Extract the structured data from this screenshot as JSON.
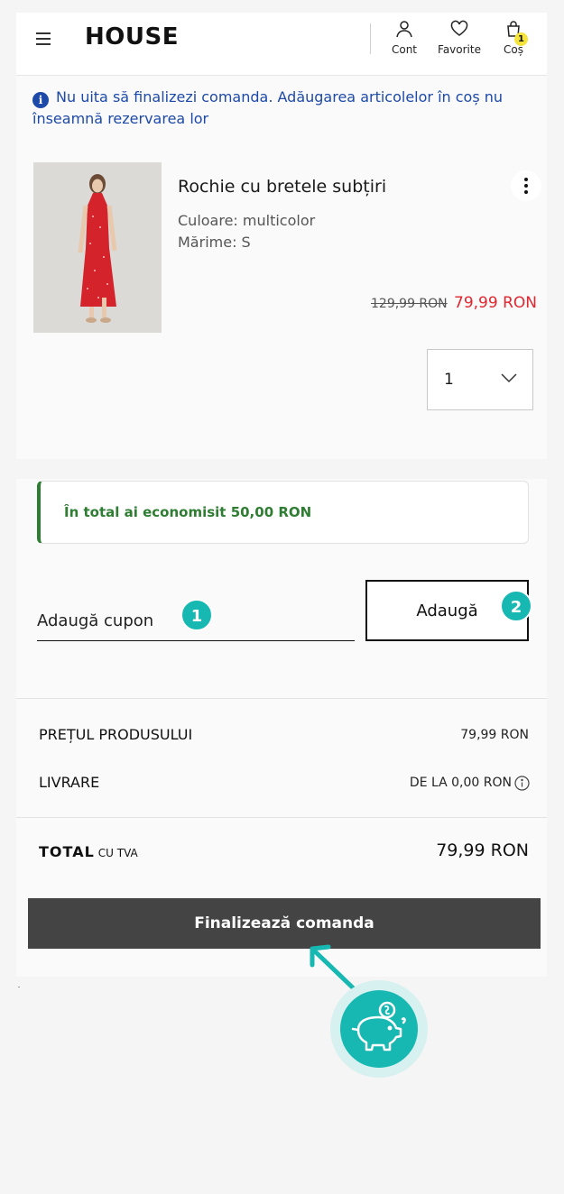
{
  "header": {
    "logo": "HOUSE",
    "account_label": "Cont",
    "favorites_label": "Favorite",
    "cart_label": "Coș",
    "cart_count": "1"
  },
  "info": {
    "message": "Nu uita să finalizezi comanda. Adăugarea articolelor în coș nu înseamnă rezervarea lor"
  },
  "product": {
    "name": "Rochie cu bretele subțiri",
    "color": "Culoare: multicolor",
    "size": "Mărime: S",
    "old_price": "129,99 RON",
    "new_price": "79,99 RON",
    "quantity": "1"
  },
  "savings": {
    "text": "În total ai economisit 50,00 RON"
  },
  "coupon": {
    "placeholder": "Adaugă cupon",
    "button_label": "Adaugă",
    "step1": "1",
    "step2": "2"
  },
  "summary": {
    "product_price_label": "PREȚUL PRODUSULUI",
    "product_price_value": "79,99 RON",
    "delivery_label": "LIVRARE",
    "delivery_value": "DE LA 0,00 RON",
    "total_label": "TOTAL",
    "total_vat": "CU TVA",
    "total_value": "79,99 RON"
  },
  "checkout": {
    "button_label": "Finalizează comanda"
  },
  "colors": {
    "accent_teal": "#17b8b2",
    "price_red": "#e0262f",
    "savings_green": "#2e7d32",
    "info_blue": "#1d4aa8",
    "checkout_bg": "#444444"
  }
}
